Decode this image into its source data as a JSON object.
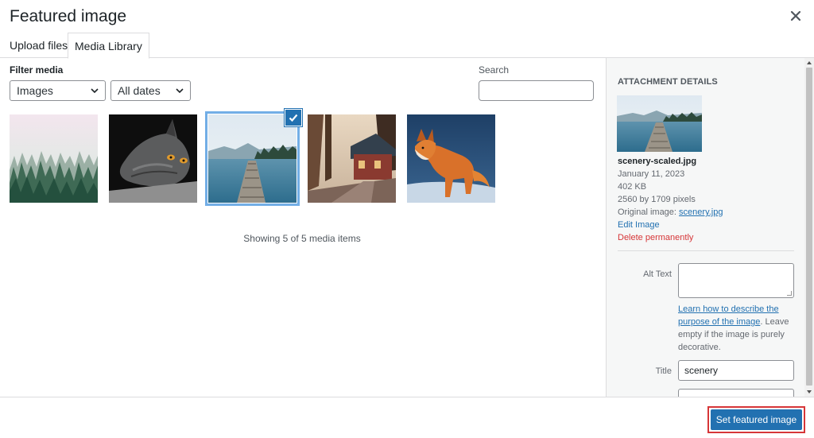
{
  "modal": {
    "title": "Featured image",
    "close_icon": "close-icon"
  },
  "tabs": [
    {
      "label": "Upload files",
      "active": false
    },
    {
      "label": "Media Library",
      "active": true
    }
  ],
  "filters": {
    "label": "Filter media",
    "type_select": {
      "value": "Images"
    },
    "date_select": {
      "value": "All dates"
    }
  },
  "search": {
    "label": "Search",
    "value": ""
  },
  "media_items": [
    {
      "name": "foggy-forest",
      "selected": false
    },
    {
      "name": "cat",
      "selected": false
    },
    {
      "name": "scenery",
      "selected": true
    },
    {
      "name": "house",
      "selected": false
    },
    {
      "name": "fox",
      "selected": false
    }
  ],
  "status": {
    "count_text": "Showing 5 of 5 media items"
  },
  "attachment_details": {
    "heading": "Attachment Details",
    "filename": "scenery-scaled.jpg",
    "date": "January 11, 2023",
    "size": "402 KB",
    "dimensions": "2560 by 1709 pixels",
    "original_label": "Original image:",
    "original_link": "scenery.jpg",
    "edit_link": "Edit Image",
    "delete_link": "Delete permanently",
    "alt_text_label": "Alt Text",
    "alt_text_value": "",
    "alt_help_link": "Learn how to describe the purpose of the image",
    "alt_help_text": ". Leave empty if the image is purely decorative.",
    "title_label": "Title",
    "title_value": "scenery"
  },
  "footer": {
    "primary_button": "Set featured image"
  },
  "colors": {
    "accent": "#2271b1",
    "selection_ring": "#72aee6",
    "danger": "#d63638",
    "highlight_border": "#d63638"
  }
}
